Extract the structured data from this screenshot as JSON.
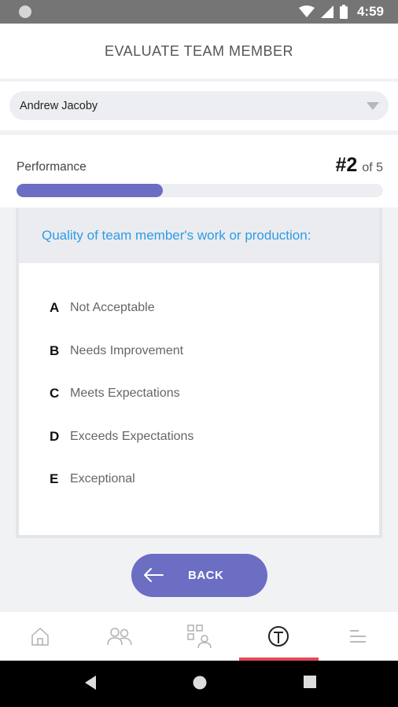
{
  "status_bar": {
    "time": "4:59",
    "icons": [
      "notification-dot-icon",
      "wifi-icon",
      "signal-icon",
      "battery-icon"
    ]
  },
  "header": {
    "title": "EVALUATE TEAM MEMBER"
  },
  "member_select": {
    "selected": "Andrew Jacoby",
    "icon": "chevron-down-icon"
  },
  "progress": {
    "section": "Performance",
    "current": "#2",
    "total": "of 5",
    "fill_fraction": 0.4
  },
  "question": {
    "text": "Quality of team member's work or production:",
    "options": [
      {
        "letter": "A",
        "text": "Not Acceptable"
      },
      {
        "letter": "B",
        "text": "Needs Improvement"
      },
      {
        "letter": "C",
        "text": "Meets Expectations"
      },
      {
        "letter": "D",
        "text": "Exceeds Expectations"
      },
      {
        "letter": "E",
        "text": "Exceptional"
      }
    ]
  },
  "back_button": {
    "label": "BACK",
    "icon": "arrow-left-icon"
  },
  "bottom_nav": {
    "items": [
      "home-icon",
      "team-icon",
      "qr-profile-icon",
      "evaluate-icon",
      "menu-icon"
    ],
    "active_index": 3
  },
  "system_nav": [
    "back-triangle-icon",
    "home-circle-icon",
    "recents-square-icon"
  ],
  "colors": {
    "accent": "#6b6ec3",
    "question_text": "#2f9be6",
    "active_tab_indicator": "#e64856",
    "status_bar": "#757575"
  }
}
